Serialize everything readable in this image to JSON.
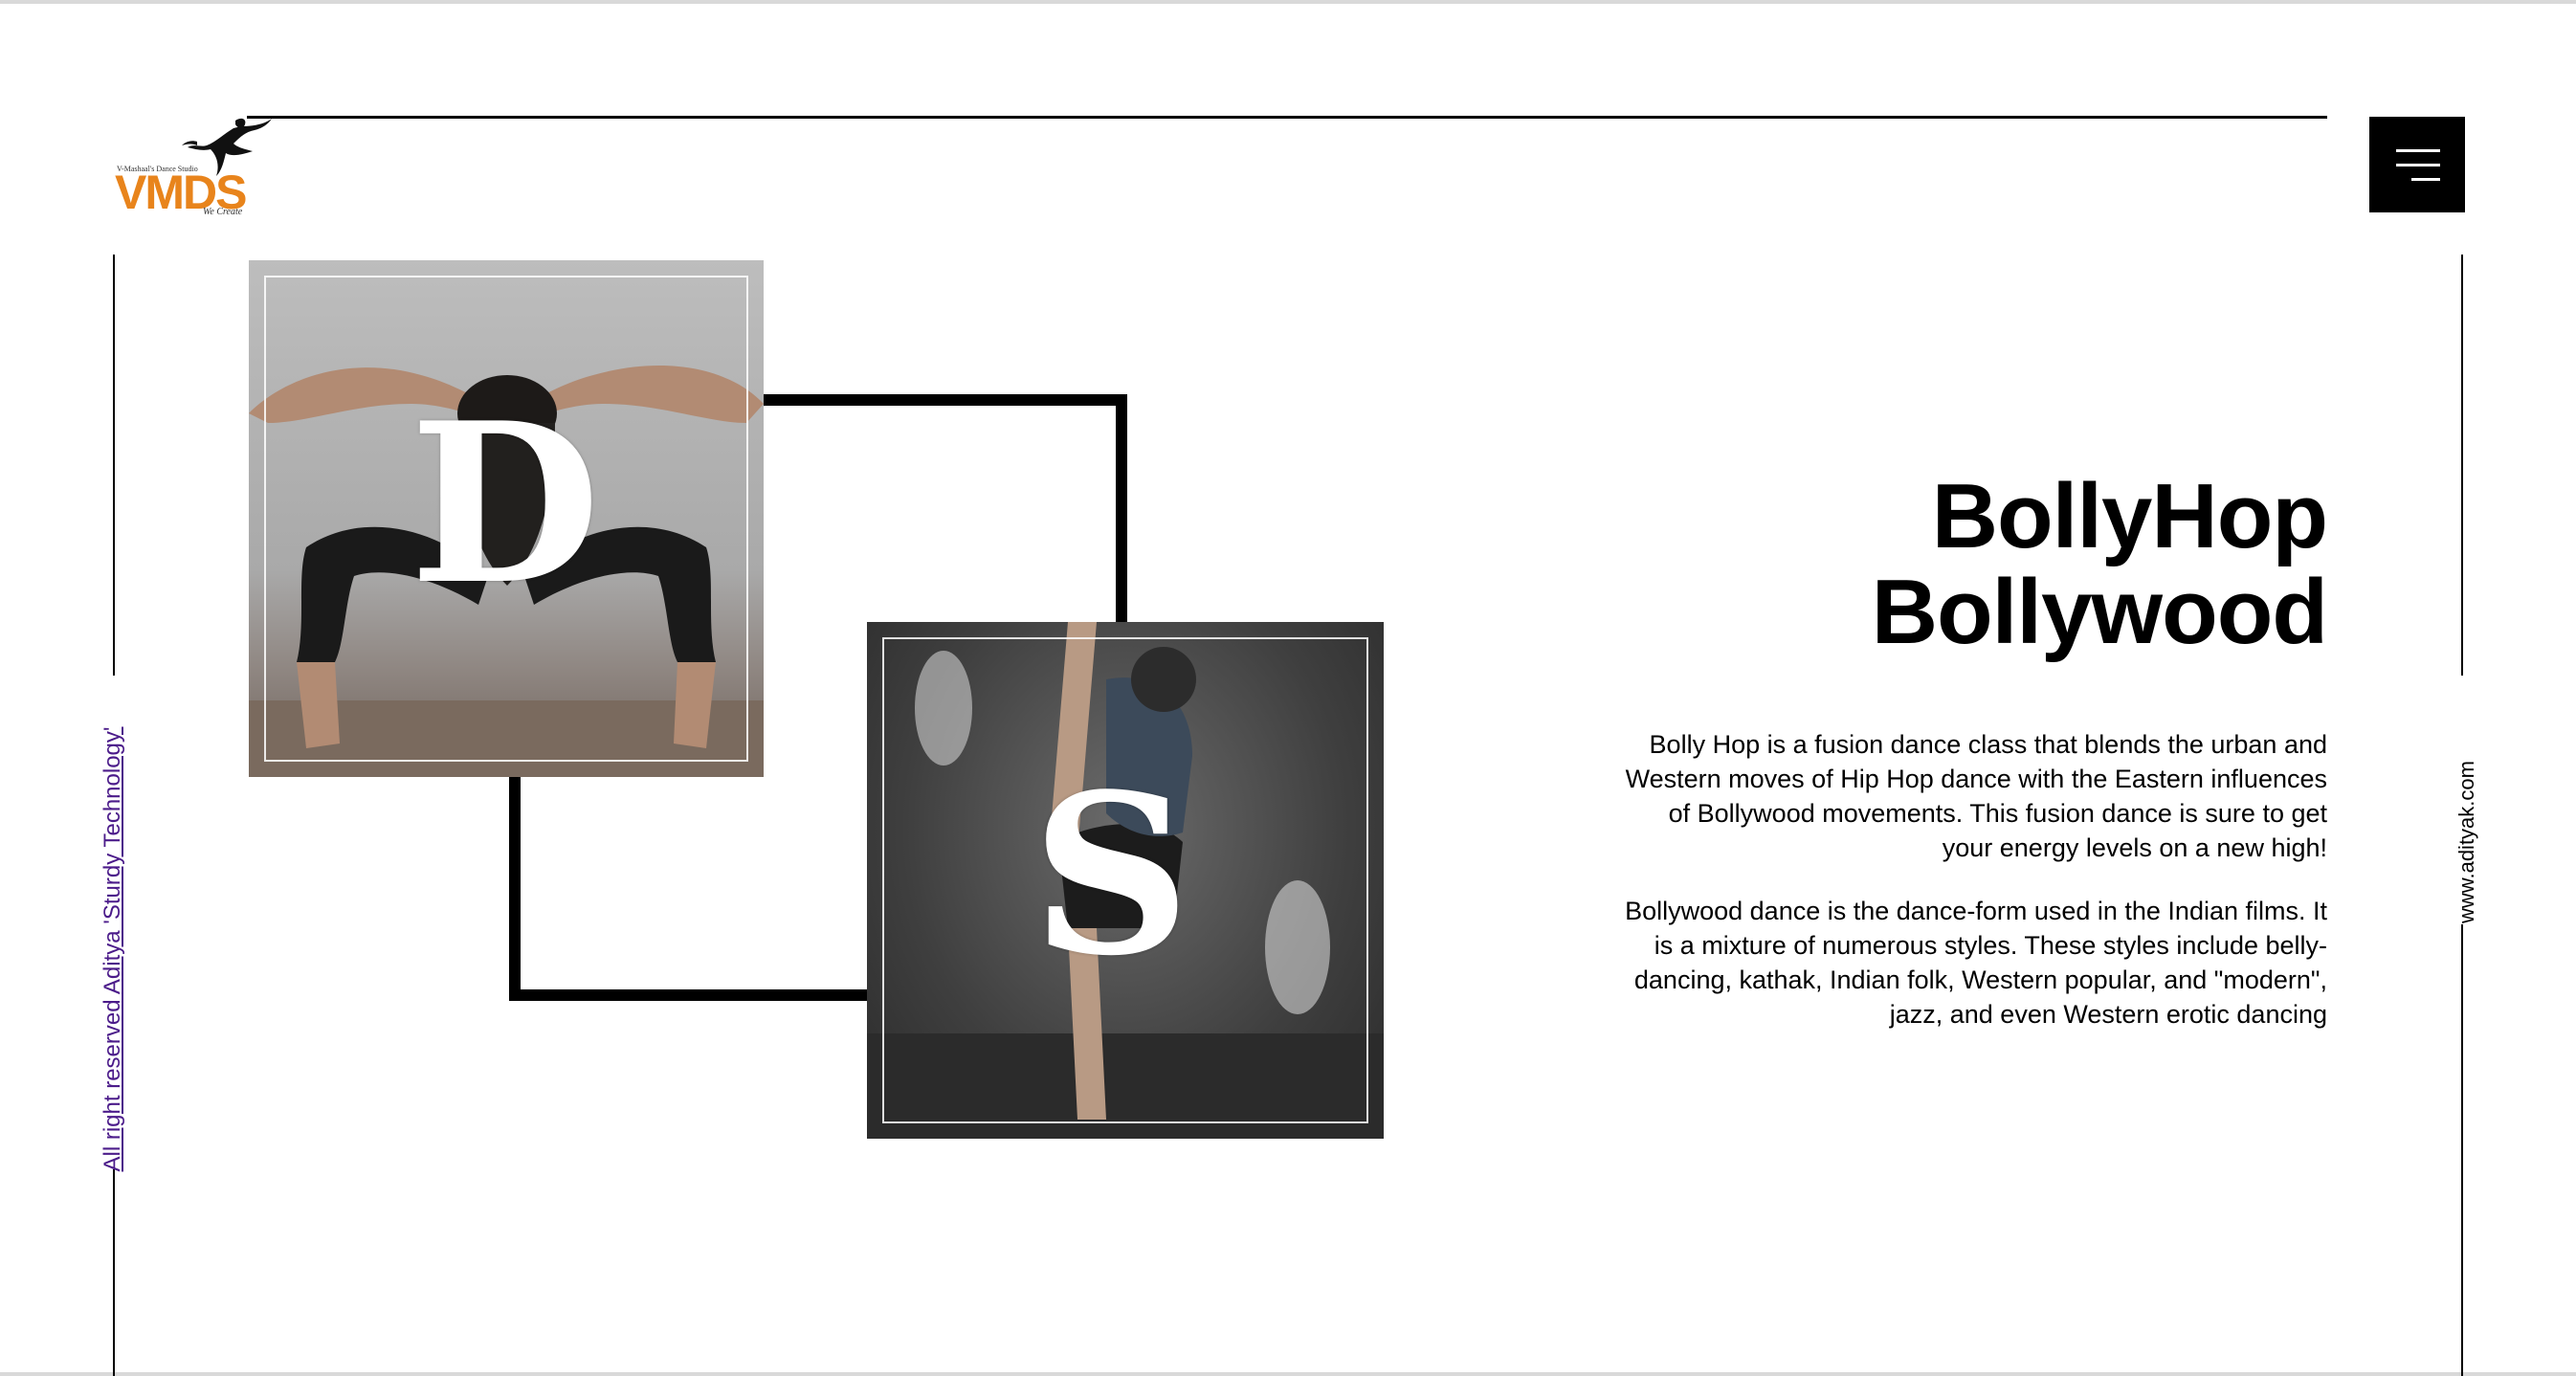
{
  "brand": {
    "logo_text": "VMDS",
    "logo_tagline": "V-Mashaal's Dance Studio",
    "logo_subtext": "We Create",
    "accent_color": "#e8841c"
  },
  "header": {
    "menu_icon": "hamburger-menu-icon"
  },
  "gallery": {
    "letter_1": "D",
    "letter_2": "S"
  },
  "content": {
    "title_line1": "BollyHop",
    "title_line2": "Bollywood",
    "paragraph_1": "Bolly Hop is a fusion dance class that blends the urban and Western moves of Hip Hop dance with the Eastern influences of Bollywood movements. This fusion dance is sure to get your energy levels on a new high!",
    "paragraph_2": "Bollywood dance is the dance-form used in the Indian films. It is a mixture of numerous styles. These styles include belly-dancing, kathak, Indian folk, Western popular, and \"modern\", jazz, and even Western erotic dancing"
  },
  "footer": {
    "left_credit": "All right reserved Aditya 'Sturdy Technology'",
    "right_site": "www.adityak.com",
    "link_color": "#4b1b8a"
  }
}
